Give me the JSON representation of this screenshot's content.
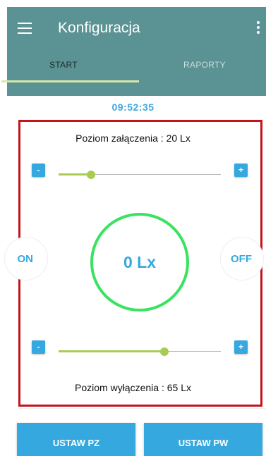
{
  "appbar": {
    "title": "Konfiguracja",
    "menu_icon": "hamburger-menu-icon",
    "overflow_icon": "vertical-dots-icon",
    "background": "#5b9293"
  },
  "tabs": [
    {
      "label": "START",
      "active": true
    },
    {
      "label": "RAPORTY",
      "active": false
    }
  ],
  "time": "09:52:35",
  "panel": {
    "level_on_label": "Poziom załączenia : 20 Lx",
    "level_off_label": "Poziom wyłączenia : 65 Lx",
    "slider_on_value_fraction": 0.2,
    "slider_off_value_fraction": 0.65,
    "minus": "-",
    "plus": "+",
    "on_label": "ON",
    "off_label": "OFF",
    "reading": "0 Lx",
    "border_color": "#c2151b",
    "ring_color": "#39e361",
    "slider_color": "#a8cc52"
  },
  "actions": {
    "set_pz": "USTAW PZ",
    "set_pw": "USTAW PW",
    "button_color": "#36a8e0"
  }
}
